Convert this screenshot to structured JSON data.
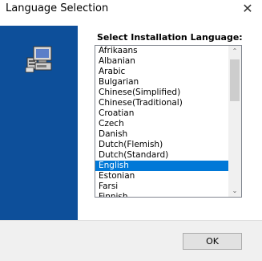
{
  "window": {
    "title": "Language Selection",
    "close_glyph": "✕"
  },
  "prompt": "Select Installation Language:",
  "languages": [
    "Afrikaans",
    "Albanian",
    "Arabic",
    "Bulgarian",
    "Chinese(Simplified)",
    "Chinese(Traditional)",
    "Croatian",
    "Czech",
    "Danish",
    "Dutch(Flemish)",
    "Dutch(Standard)",
    "English",
    "Estonian",
    "Farsi",
    "Finnish"
  ],
  "selected_language": "English",
  "scroll": {
    "up_glyph": "⌃",
    "down_glyph": "⌄"
  },
  "buttons": {
    "ok": "OK"
  },
  "colors": {
    "banner": "#0d4f9a",
    "selection": "#0078d7"
  }
}
